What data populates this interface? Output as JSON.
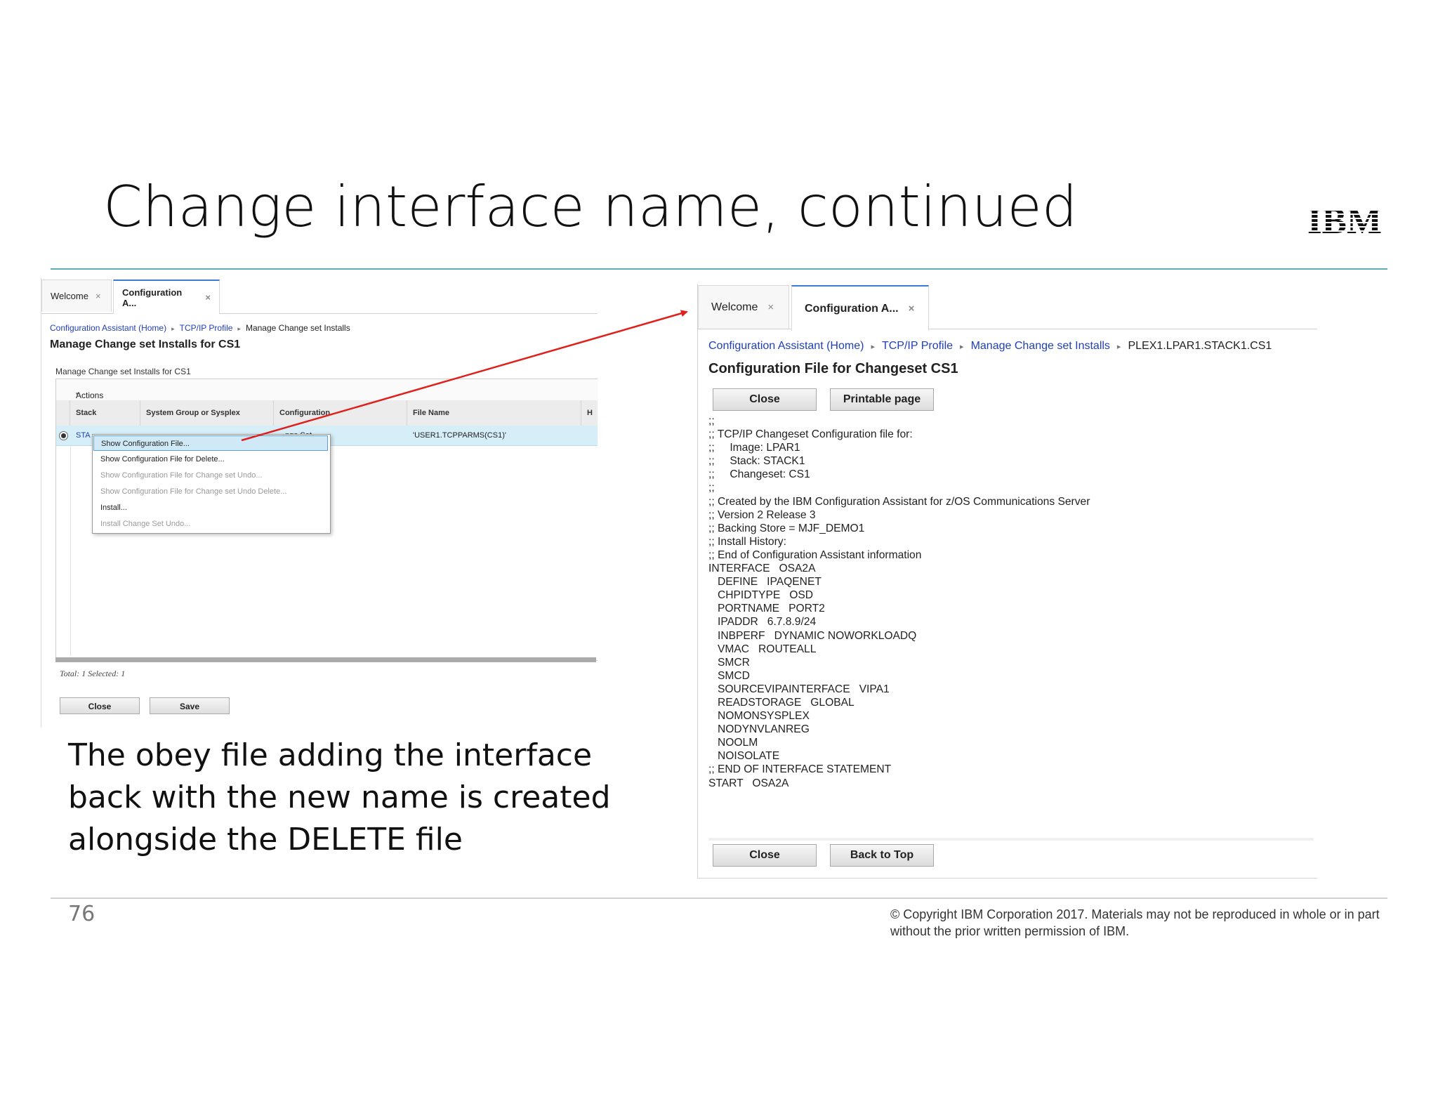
{
  "slide": {
    "title": "Change interface name, continued",
    "logo": "IBM",
    "caption": "The obey file adding the interface back with the new name is created alongside the DELETE file",
    "page_number": "76",
    "copyright": "© Copyright IBM Corporation 2017.  Materials may not be reproduced in whole or in part without the prior written permission of IBM."
  },
  "left_window": {
    "tabs": [
      {
        "label": "Welcome",
        "close": "×"
      },
      {
        "label": "Configuration A...",
        "close": "×"
      }
    ],
    "breadcrumb": {
      "home": "Configuration Assistant (Home)",
      "profile": "TCP/IP Profile",
      "current": "Manage Change set Installs",
      "separator": "▸"
    },
    "title": "Manage Change set Installs for CS1",
    "table_label": "Manage Change set Installs for CS1",
    "actions_label": "Actions",
    "actions_caret": "▾",
    "columns": [
      "Stack",
      "System Group or Sysplex",
      "Configuration",
      "File Name",
      "H"
    ],
    "row": {
      "stack": "STA",
      "configuration": "nge Set",
      "file_name": "'USER1.TCPPARMS(CS1)'"
    },
    "context_menu": [
      {
        "label": "Show Configuration File...",
        "state": "highlighted"
      },
      {
        "label": "Show Configuration File for Delete...",
        "state": "enabled"
      },
      {
        "label": "Show Configuration File for Change set Undo...",
        "state": "disabled"
      },
      {
        "label": "Show Configuration File for Change set Undo Delete...",
        "state": "disabled"
      },
      {
        "label": "Install...",
        "state": "enabled"
      },
      {
        "label": "Install Change Set Undo...",
        "state": "disabled"
      }
    ],
    "total": "Total: 1 Selected: 1",
    "buttons": {
      "close": "Close",
      "save": "Save"
    }
  },
  "right_window": {
    "tabs": [
      {
        "label": "Welcome",
        "close": "×"
      },
      {
        "label": "Configuration A...",
        "close": "×"
      }
    ],
    "breadcrumb": {
      "home": "Configuration Assistant (Home)",
      "profile": "TCP/IP Profile",
      "installs": "Manage Change set Installs",
      "current": "PLEX1.LPAR1.STACK1.CS1",
      "separator": "▸"
    },
    "title": "Configuration File for Changeset CS1",
    "top_buttons": {
      "close": "Close",
      "print": "Printable page"
    },
    "config_text": ";;\n;; TCP/IP Changeset Configuration file for:\n;;     Image: LPAR1\n;;     Stack: STACK1\n;;     Changeset: CS1\n;;\n;; Created by the IBM Configuration Assistant for z/OS Communications Server\n;; Version 2 Release 3\n;; Backing Store = MJF_DEMO1\n;; Install History:\n;; End of Configuration Assistant information\nINTERFACE   OSA2A\n   DEFINE   IPAQENET\n   CHPIDTYPE   OSD\n   PORTNAME   PORT2\n   IPADDR   6.7.8.9/24\n   INBPERF   DYNAMIC NOWORKLOADQ\n   VMAC   ROUTEALL\n   SMCR\n   SMCD\n   SOURCEVIPAINTERFACE   VIPA1\n   READSTORAGE   GLOBAL\n   NOMONSYSPLEX\n   NODYNVLANREG\n   NOOLM\n   NOISOLATE\n;; END OF INTERFACE STATEMENT\nSTART   OSA2A",
    "bottom_buttons": {
      "close": "Close",
      "top": "Back to Top"
    }
  },
  "colors": {
    "accent_rule": "#5aaeb1",
    "link": "#1f3fb5",
    "arrow": "#e0201b",
    "selection": "#d6eef8"
  }
}
